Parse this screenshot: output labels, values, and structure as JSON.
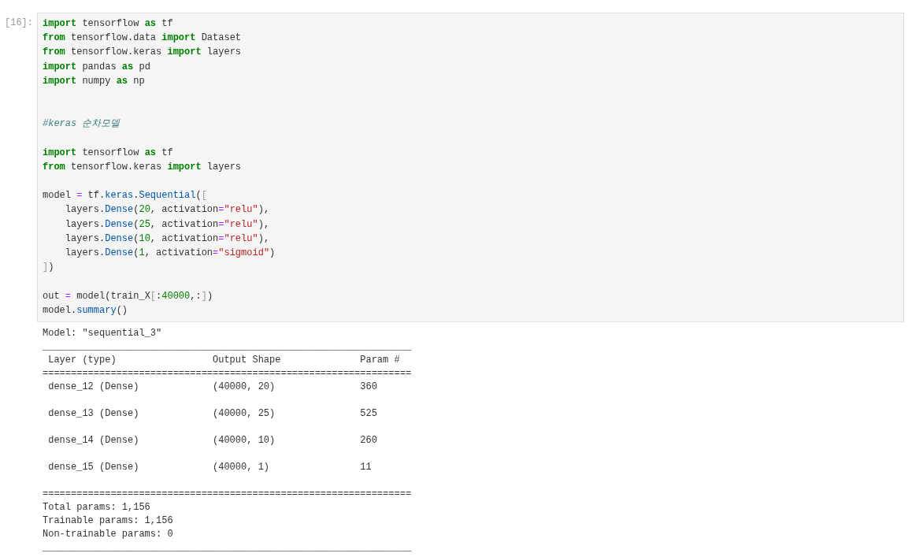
{
  "cell": {
    "prompt": "[16]:",
    "code_lines": [
      {
        "kind": "code",
        "tokens": [
          {
            "text": "import",
            "kind": "keyword"
          },
          {
            "text": " tensorflow ",
            "kind": "name"
          },
          {
            "text": "as",
            "kind": "keyword"
          },
          {
            "text": " tf",
            "kind": "name"
          }
        ]
      },
      {
        "kind": "code",
        "tokens": [
          {
            "text": "from",
            "kind": "keyword"
          },
          {
            "text": " tensorflow.data ",
            "kind": "name"
          },
          {
            "text": "import",
            "kind": "keyword"
          },
          {
            "text": " Dataset",
            "kind": "name"
          }
        ]
      },
      {
        "kind": "code",
        "tokens": [
          {
            "text": "from",
            "kind": "keyword"
          },
          {
            "text": " tensorflow.keras ",
            "kind": "name"
          },
          {
            "text": "import",
            "kind": "keyword"
          },
          {
            "text": " layers",
            "kind": "name"
          }
        ]
      },
      {
        "kind": "code",
        "tokens": [
          {
            "text": "import",
            "kind": "keyword"
          },
          {
            "text": " pandas ",
            "kind": "name"
          },
          {
            "text": "as",
            "kind": "keyword"
          },
          {
            "text": " pd",
            "kind": "name"
          }
        ]
      },
      {
        "kind": "code",
        "tokens": [
          {
            "text": "import",
            "kind": "keyword"
          },
          {
            "text": " numpy ",
            "kind": "name"
          },
          {
            "text": "as",
            "kind": "keyword"
          },
          {
            "text": " np",
            "kind": "name"
          }
        ]
      },
      {
        "kind": "blank"
      },
      {
        "kind": "blank"
      },
      {
        "kind": "code",
        "tokens": [
          {
            "text": "#keras 순차모델",
            "kind": "comment"
          }
        ]
      },
      {
        "kind": "blank"
      },
      {
        "kind": "code",
        "tokens": [
          {
            "text": "import",
            "kind": "keyword"
          },
          {
            "text": " tensorflow ",
            "kind": "name"
          },
          {
            "text": "as",
            "kind": "keyword"
          },
          {
            "text": " tf",
            "kind": "name"
          }
        ]
      },
      {
        "kind": "code",
        "tokens": [
          {
            "text": "from",
            "kind": "keyword"
          },
          {
            "text": " tensorflow.keras ",
            "kind": "name"
          },
          {
            "text": "import",
            "kind": "keyword"
          },
          {
            "text": " layers",
            "kind": "name"
          }
        ]
      },
      {
        "kind": "blank"
      },
      {
        "kind": "code",
        "tokens": [
          {
            "text": "model ",
            "kind": "name"
          },
          {
            "text": "=",
            "kind": "operator"
          },
          {
            "text": " tf.",
            "kind": "name"
          },
          {
            "text": "keras",
            "kind": "property"
          },
          {
            "text": ".",
            "kind": "name"
          },
          {
            "text": "Sequential",
            "kind": "property"
          },
          {
            "text": "(",
            "kind": "name"
          },
          {
            "text": "[",
            "kind": "bracket"
          }
        ]
      },
      {
        "kind": "code",
        "tokens": [
          {
            "text": "    layers.",
            "kind": "name"
          },
          {
            "text": "Dense",
            "kind": "property"
          },
          {
            "text": "(",
            "kind": "name"
          },
          {
            "text": "20",
            "kind": "number"
          },
          {
            "text": ", activation",
            "kind": "name"
          },
          {
            "text": "=",
            "kind": "operator"
          },
          {
            "text": "\"relu\"",
            "kind": "string"
          },
          {
            "text": "),",
            "kind": "name"
          }
        ]
      },
      {
        "kind": "code",
        "tokens": [
          {
            "text": "    layers.",
            "kind": "name"
          },
          {
            "text": "Dense",
            "kind": "property"
          },
          {
            "text": "(",
            "kind": "name"
          },
          {
            "text": "25",
            "kind": "number"
          },
          {
            "text": ", activation",
            "kind": "name"
          },
          {
            "text": "=",
            "kind": "operator"
          },
          {
            "text": "\"relu\"",
            "kind": "string"
          },
          {
            "text": "),",
            "kind": "name"
          }
        ]
      },
      {
        "kind": "code",
        "tokens": [
          {
            "text": "    layers.",
            "kind": "name"
          },
          {
            "text": "Dense",
            "kind": "property"
          },
          {
            "text": "(",
            "kind": "name"
          },
          {
            "text": "10",
            "kind": "number"
          },
          {
            "text": ", activation",
            "kind": "name"
          },
          {
            "text": "=",
            "kind": "operator"
          },
          {
            "text": "\"relu\"",
            "kind": "string"
          },
          {
            "text": "),",
            "kind": "name"
          }
        ]
      },
      {
        "kind": "code",
        "tokens": [
          {
            "text": "    layers.",
            "kind": "name"
          },
          {
            "text": "Dense",
            "kind": "property"
          },
          {
            "text": "(",
            "kind": "name"
          },
          {
            "text": "1",
            "kind": "number"
          },
          {
            "text": ", activation",
            "kind": "name"
          },
          {
            "text": "=",
            "kind": "operator"
          },
          {
            "text": "\"sigmoid\"",
            "kind": "string"
          },
          {
            "text": ")",
            "kind": "name"
          }
        ]
      },
      {
        "kind": "code",
        "tokens": [
          {
            "text": "]",
            "kind": "bracket"
          },
          {
            "text": ")",
            "kind": "name"
          }
        ]
      },
      {
        "kind": "blank"
      },
      {
        "kind": "code",
        "tokens": [
          {
            "text": "out ",
            "kind": "name"
          },
          {
            "text": "=",
            "kind": "operator"
          },
          {
            "text": " model(train_X",
            "kind": "name"
          },
          {
            "text": "[",
            "kind": "bracket"
          },
          {
            "text": ":",
            "kind": "name"
          },
          {
            "text": "40000",
            "kind": "number"
          },
          {
            "text": ",:",
            "kind": "name"
          },
          {
            "text": "]",
            "kind": "bracket"
          },
          {
            "text": ")",
            "kind": "name"
          }
        ]
      },
      {
        "kind": "code",
        "tokens": [
          {
            "text": "model.",
            "kind": "name"
          },
          {
            "text": "summary",
            "kind": "property"
          },
          {
            "text": "()",
            "kind": "name"
          }
        ]
      }
    ]
  },
  "output": {
    "lines": [
      {
        "kind": "text",
        "text": "Model: \"sequential_3\""
      },
      {
        "kind": "rule",
        "text": "_________________________________________________________________"
      },
      {
        "kind": "header",
        "cells": [
          "Layer (type)",
          "Output Shape",
          "Param #"
        ]
      },
      {
        "kind": "rule",
        "text": "================================================================="
      },
      {
        "kind": "row",
        "cells": [
          "dense_12 (Dense)",
          "(40000, 20)",
          "360"
        ]
      },
      {
        "kind": "row",
        "cells": [
          "dense_13 (Dense)",
          "(40000, 25)",
          "525"
        ]
      },
      {
        "kind": "row",
        "cells": [
          "dense_14 (Dense)",
          "(40000, 10)",
          "260"
        ]
      },
      {
        "kind": "row",
        "cells": [
          "dense_15 (Dense)",
          "(40000, 1)",
          "11"
        ]
      },
      {
        "kind": "rule",
        "text": "================================================================="
      },
      {
        "kind": "text",
        "text": "Total params: 1,156"
      },
      {
        "kind": "text",
        "text": "Trainable params: 1,156"
      },
      {
        "kind": "text",
        "text": "Non-trainable params: 0"
      },
      {
        "kind": "rule",
        "text": "_________________________________________________________________"
      }
    ]
  }
}
